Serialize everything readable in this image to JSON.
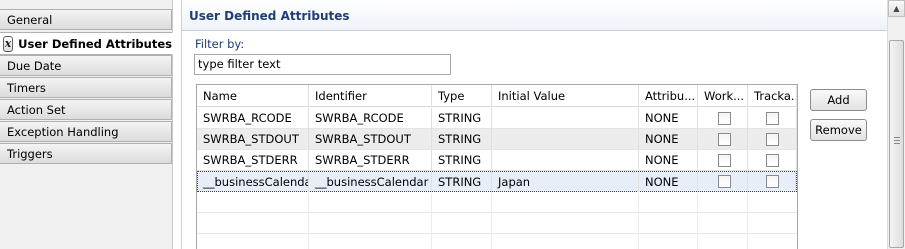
{
  "tabs": [
    {
      "label": "General",
      "active": false
    },
    {
      "label": "User Defined Attributes",
      "active": true,
      "icon": "x-variable-icon",
      "icon_glyph": "x"
    },
    {
      "label": "Due Date",
      "active": false
    },
    {
      "label": "Timers",
      "active": false
    },
    {
      "label": "Action Set",
      "active": false
    },
    {
      "label": "Exception Handling",
      "active": false
    },
    {
      "label": "Triggers",
      "active": false
    }
  ],
  "section": {
    "title": "User Defined Attributes",
    "filter_label": "Filter by:",
    "filter_value": "type filter text"
  },
  "table": {
    "columns": [
      "Name",
      "Identifier",
      "Type",
      "Initial Value",
      "Attribu...",
      "Work...",
      "Tracka..."
    ],
    "rows": [
      {
        "name": "SWRBA_RCODE",
        "identifier": "SWRBA_RCODE",
        "type": "STRING",
        "initial_value": "",
        "attribute": "NONE",
        "work": false,
        "trackable": false
      },
      {
        "name": "SWRBA_STDOUT",
        "identifier": "SWRBA_STDOUT",
        "type": "STRING",
        "initial_value": "",
        "attribute": "NONE",
        "work": false,
        "trackable": false
      },
      {
        "name": "SWRBA_STDERR",
        "identifier": "SWRBA_STDERR",
        "type": "STRING",
        "initial_value": "",
        "attribute": "NONE",
        "work": false,
        "trackable": false
      },
      {
        "name": "__businessCalendar",
        "identifier": "__businessCalendar",
        "type": "STRING",
        "initial_value": "Japan",
        "attribute": "NONE",
        "work": false,
        "trackable": false
      }
    ]
  },
  "buttons": {
    "add": "Add",
    "remove": "Remove"
  },
  "colors": {
    "section_title": "#1f3e73",
    "row_alt": "#ececec",
    "row_selected": "#e8eef8"
  }
}
